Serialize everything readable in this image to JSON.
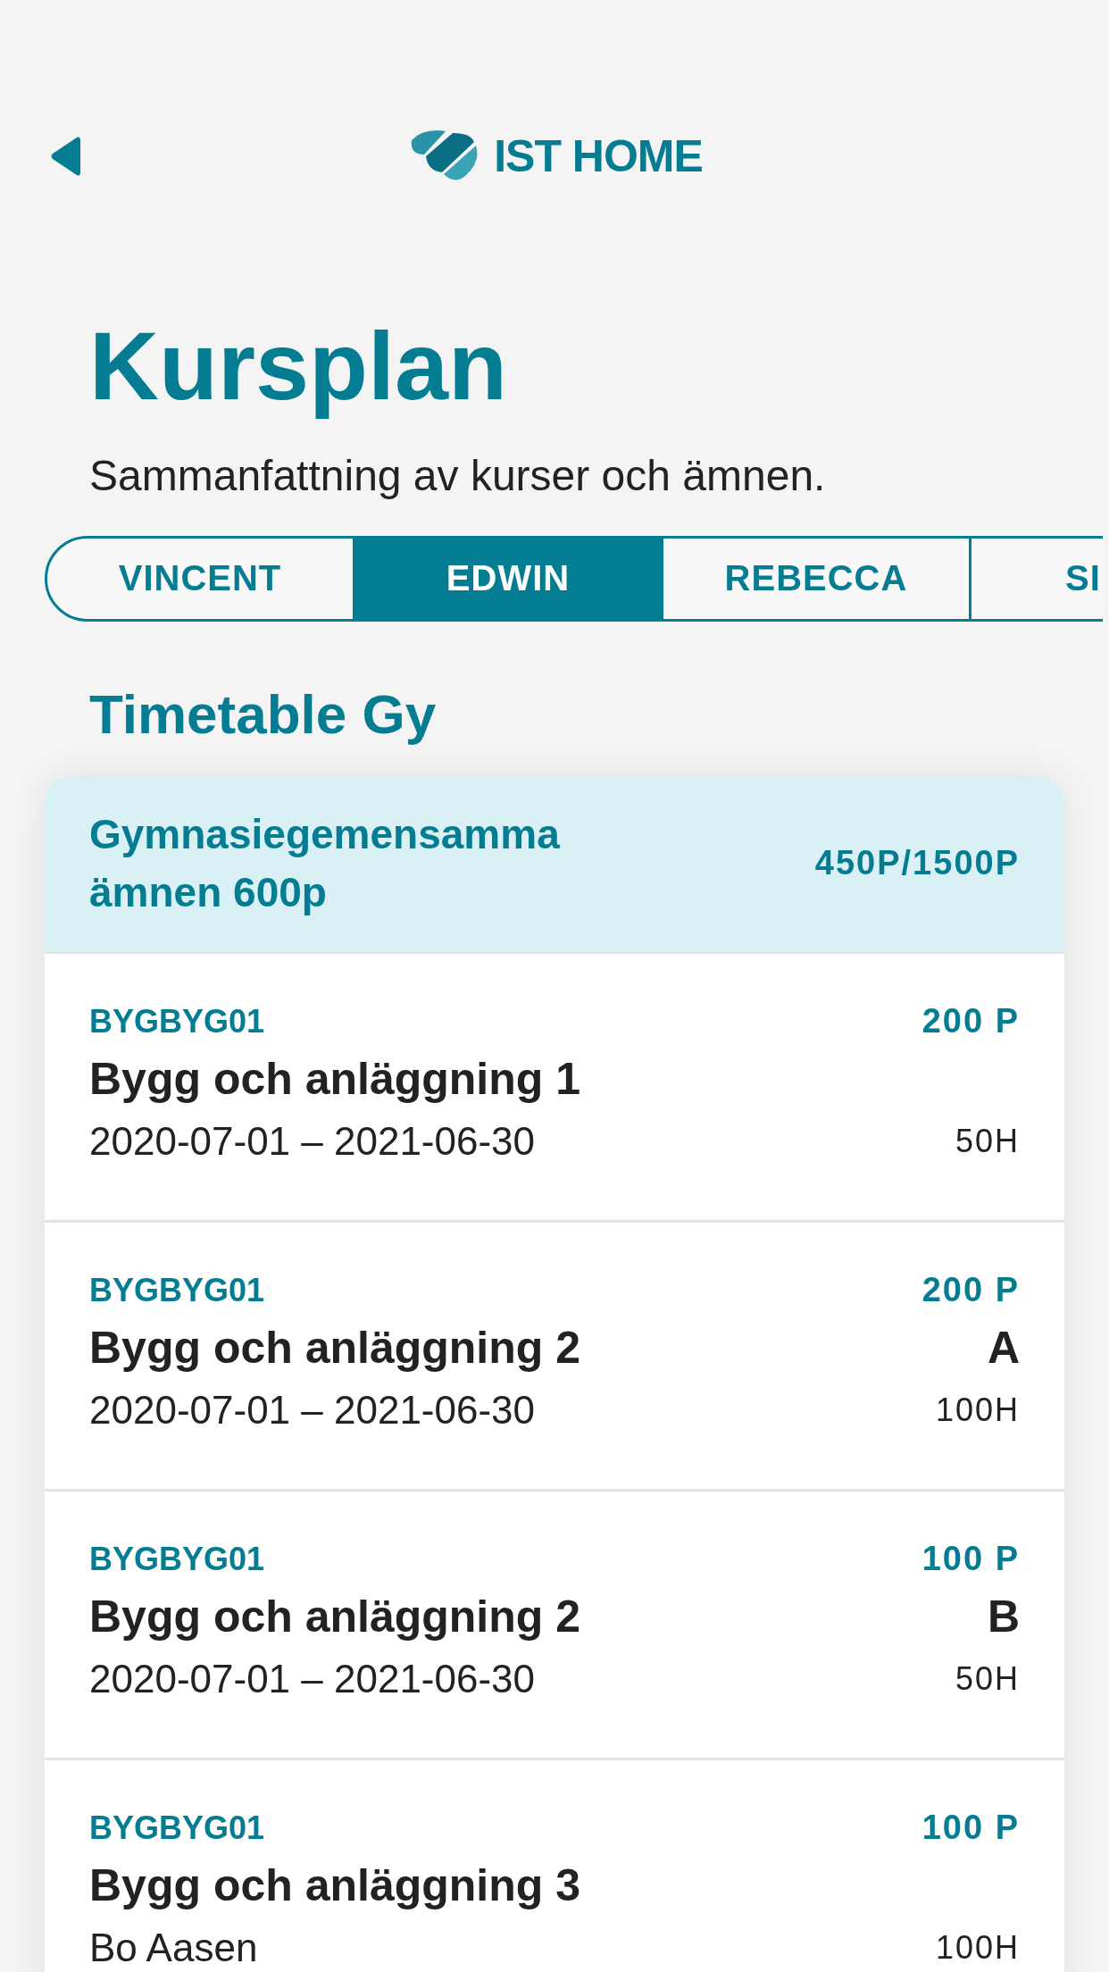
{
  "header": {
    "logo_text": "IST HOME"
  },
  "title": "Kursplan",
  "subtitle": "Sammanfattning av kurser och ämnen.",
  "tabs": [
    {
      "label": "VINCENT",
      "selected": false
    },
    {
      "label": "EDWIN",
      "selected": true
    },
    {
      "label": "REBECCA",
      "selected": false
    },
    {
      "label": "SI",
      "selected": false
    }
  ],
  "section_title": "Timetable Gy",
  "group": {
    "title": "Gymnasiegemensamma ämnen 600p",
    "points": "450P/1500P"
  },
  "courses": [
    {
      "code": "BYGBYG01",
      "points": "200 P",
      "name": "Bygg och anläggning 1",
      "detail": "2020-07-01 – 2021-06-30",
      "hours": "50H"
    },
    {
      "code": "BYGBYG01",
      "points": "200 P",
      "name": "Bygg och anläggning 2",
      "grade": "A",
      "detail": "2020-07-01 – 2021-06-30",
      "hours": "100H"
    },
    {
      "code": "BYGBYG01",
      "points": "100 P",
      "name": "Bygg och anläggning 2",
      "grade": "B",
      "detail": "2020-07-01 – 2021-06-30",
      "hours": "50H"
    },
    {
      "code": "BYGBYG01",
      "points": "100 P",
      "name": "Bygg och anläggning 3",
      "detail": "Bo Aasen",
      "hours": "100H"
    }
  ]
}
